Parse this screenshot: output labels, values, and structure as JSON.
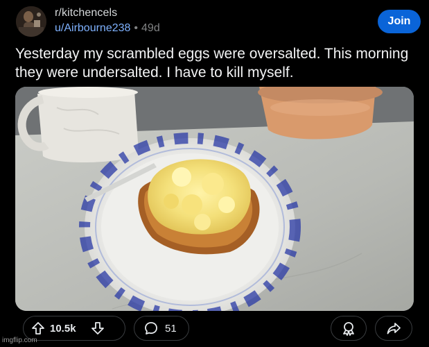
{
  "post": {
    "subreddit": "r/kitchencels",
    "author": "u/Airbourne238",
    "separator": "•",
    "age": "49d",
    "title": "Yesterday my scrambled eggs were oversalted. This morning they were undersalted. I have to kill myself."
  },
  "header": {
    "join_label": "Join"
  },
  "actions": {
    "upvotes": "10.5k",
    "comments": "51"
  },
  "icons": {
    "upvote": "arrow-up-icon",
    "downvote": "arrow-down-icon",
    "comment": "speech-bubble-icon",
    "award": "award-icon",
    "share": "share-arrow-icon"
  },
  "colors": {
    "background": "#000000",
    "join_button": "#0a64d8",
    "username": "#7fb2ff",
    "muted": "#818384"
  },
  "watermark": "imgflip.com"
}
